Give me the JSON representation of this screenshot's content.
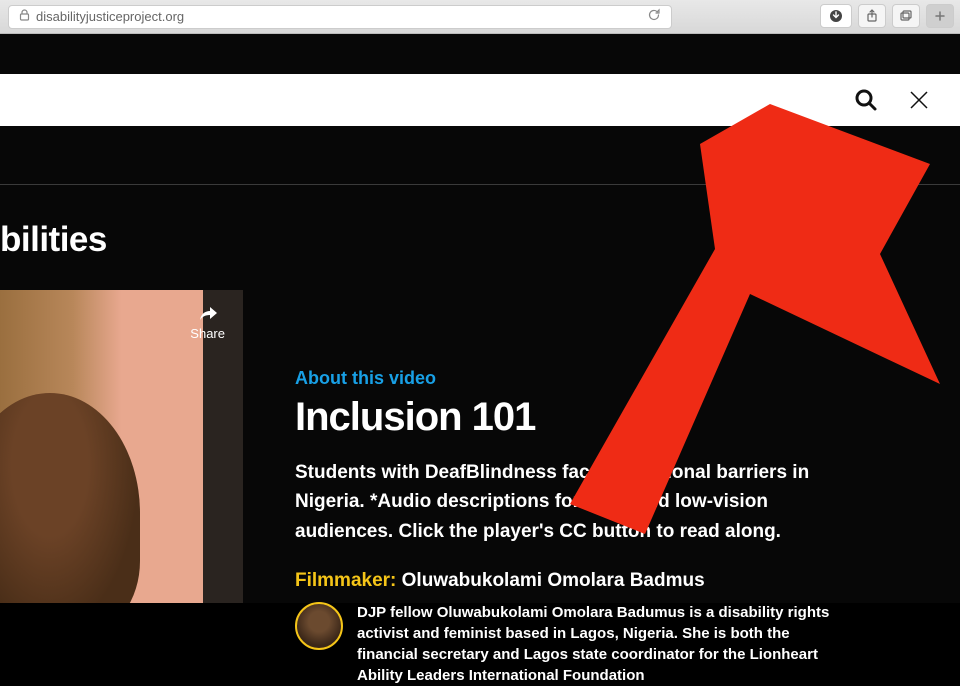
{
  "browser": {
    "url": "disabilityjusticeproject.org"
  },
  "page": {
    "heading_fragment": "bilities",
    "eyebrow": "About this video",
    "title": "Inclusion 101",
    "description": "Students with DeafBlindness face educational barriers in Nigeria. *Audio descriptions for blind and low-vision audiences. Click the player's CC button to read along.",
    "filmmaker_label": "Filmmaker:",
    "filmmaker_name": "Oluwabukolami Omolara Badmus",
    "bio": "DJP fellow Oluwabukolami Omolara Badumus is a disability rights activist and feminist based in Lagos, Nigeria. She is both the financial secretary and Lagos state coordinator for the Lionheart Ability Leaders International Foundation",
    "share_label": "Share"
  }
}
